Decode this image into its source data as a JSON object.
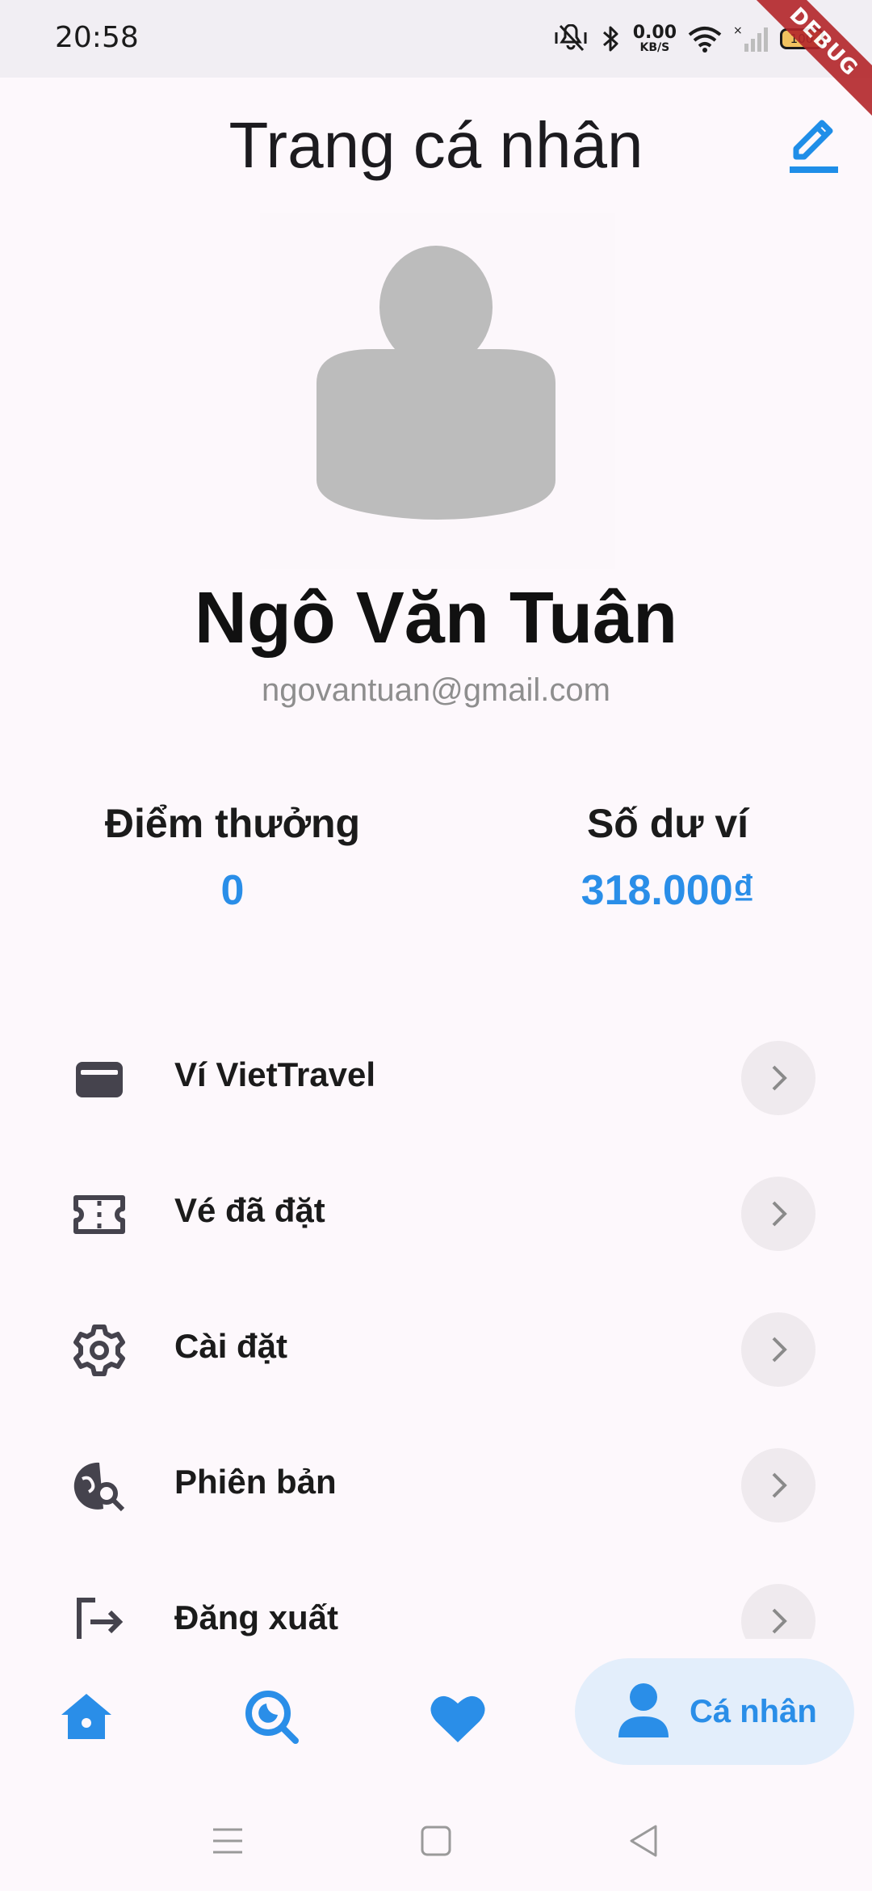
{
  "status_bar": {
    "time": "20:58",
    "net_speed_value": "0.00",
    "net_speed_unit": "KB/S",
    "battery": "100",
    "icons": [
      "mute-vibrate-icon",
      "bluetooth-icon",
      "wifi-icon",
      "no-signal-icon",
      "battery-icon"
    ]
  },
  "debug_banner": "DEBUG",
  "header": {
    "title": "Trang cá nhân",
    "edit_icon": "edit-icon"
  },
  "profile": {
    "name": "Ngô Văn Tuân",
    "email": "ngovantuan@gmail.com"
  },
  "stats": {
    "points_label": "Điểm thưởng",
    "points_value": "0",
    "balance_label": "Số dư ví",
    "balance_value": "318.000₫"
  },
  "menu": [
    {
      "label": "Ví VietTravel",
      "icon": "wallet-icon"
    },
    {
      "label": "Vé đã đặt",
      "icon": "ticket-icon"
    },
    {
      "label": "Cài đặt",
      "icon": "settings-icon"
    },
    {
      "label": "Phiên bản",
      "icon": "travel-explore-icon"
    },
    {
      "label": "Đăng xuất",
      "icon": "logout-icon"
    }
  ],
  "bottom_nav": {
    "items": [
      {
        "icon": "home-icon"
      },
      {
        "icon": "search-icon"
      },
      {
        "icon": "heart-icon"
      },
      {
        "icon": "person-icon",
        "label": "Cá nhân",
        "active": true
      }
    ]
  },
  "colors": {
    "accent": "#2a8ee8",
    "background": "#fdf8fc",
    "chip": "#efeaee",
    "active_pill": "#e3eefb"
  }
}
